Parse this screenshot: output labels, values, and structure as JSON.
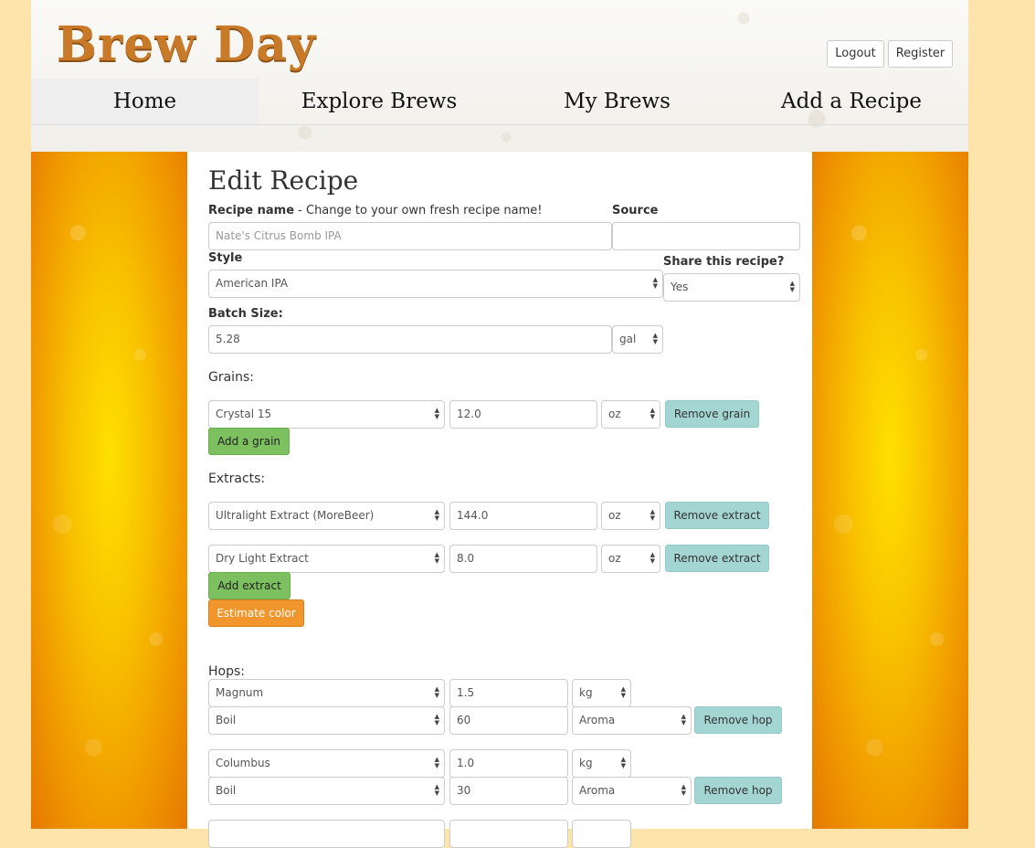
{
  "header": {
    "logo": "Brew Day",
    "logout_label": "Logout",
    "register_label": "Register"
  },
  "nav": {
    "items": [
      "Home",
      "Explore Brews",
      "My Brews",
      "Add a Recipe"
    ],
    "active": "Home"
  },
  "form": {
    "title": "Edit Recipe",
    "recipe_name_label": "Recipe name",
    "recipe_name_hint": " - Change to your own fresh recipe name!",
    "recipe_name_placeholder": "Nate's Citrus Bomb IPA",
    "source_label": "Source",
    "source_value": "",
    "style_label": "Style",
    "style_value": "American IPA",
    "share_label": "Share this recipe?",
    "share_value": "Yes",
    "batch_label": "Batch Size:",
    "batch_value": "5.28",
    "batch_unit": "gal",
    "grains_label": "Grains:",
    "grains": [
      {
        "name": "Crystal 15",
        "amount": "12.0",
        "unit": "oz",
        "remove_label": "Remove grain"
      }
    ],
    "add_grain_label": "Add a grain",
    "extracts_label": "Extracts:",
    "extracts": [
      {
        "name": "Ultralight Extract (MoreBeer)",
        "amount": "144.0",
        "unit": "oz",
        "remove_label": "Remove extract"
      },
      {
        "name": "Dry Light Extract",
        "amount": "8.0",
        "unit": "oz",
        "remove_label": "Remove extract"
      }
    ],
    "add_extract_label": "Add extract",
    "estimate_color_label": "Estimate color",
    "hops_label": "Hops:",
    "hops": [
      {
        "name": "Magnum",
        "amount": "1.5",
        "unit": "kg",
        "use": "Boil",
        "time": "60",
        "type": "Aroma",
        "remove_label": "Remove hop"
      },
      {
        "name": "Columbus",
        "amount": "1.0",
        "unit": "kg",
        "use": "Boil",
        "time": "30",
        "type": "Aroma",
        "remove_label": "Remove hop"
      }
    ]
  },
  "colors": {
    "page_bg": "#fde4ab",
    "logo": "#c87a28",
    "green_button": "#7dc05f",
    "teal_button": "#a3d5d3",
    "orange_button": "#f0962c"
  }
}
